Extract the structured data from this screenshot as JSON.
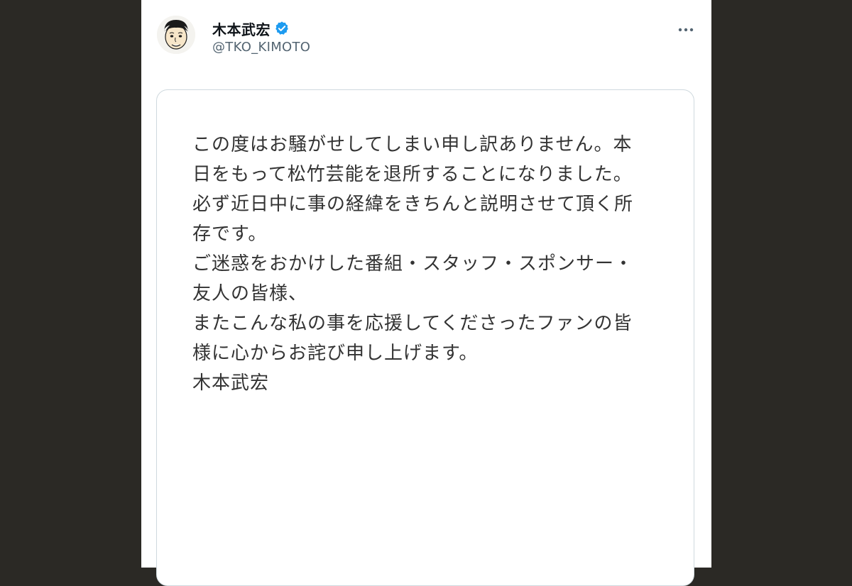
{
  "tweet": {
    "author": {
      "display_name": "木本武宏",
      "handle": "@TKO_KIMOTO",
      "verified": true,
      "verified_color": "#1d9bf0",
      "avatar_icon": "caricature-avatar"
    },
    "more_icon": "more-horizontal-icon",
    "statement": {
      "paragraph1": [
        "この度はお騒がせしてしまい申し訳ありません。本",
        "日をもって松竹芸能を退所することになりました。"
      ],
      "paragraph2": [
        "必ず近日中に事の経緯をきちんと説明させて頂く所",
        "存です。"
      ],
      "paragraph3": [
        "ご迷惑をおかけした番組・スタッフ・スポンサー・",
        "友人の皆様、",
        "またこんな私の事を応援してくださったファンの皆",
        "様に心からお詫び申し上げます。"
      ],
      "signature": "木本武宏"
    }
  }
}
